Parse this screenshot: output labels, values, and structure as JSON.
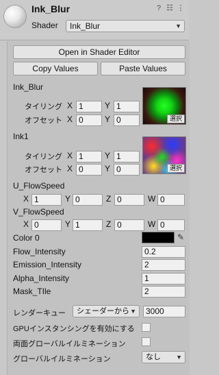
{
  "header": {
    "title": "Ink_Blur",
    "shader_label": "Shader",
    "shader_value": "Ink_Blur"
  },
  "buttons": {
    "open_shader_editor": "Open in Shader Editor",
    "copy_values": "Copy Values",
    "paste_values": "Paste Values"
  },
  "textures": [
    {
      "name": "Ink_Blur",
      "tiling_label": "タイリング",
      "offset_label": "オフセット",
      "tiling_x": "1",
      "tiling_y": "1",
      "offset_x": "0",
      "offset_y": "0",
      "select_label": "選択"
    },
    {
      "name": "Ink1",
      "tiling_label": "タイリング",
      "offset_label": "オフセット",
      "tiling_x": "1",
      "tiling_y": "1",
      "offset_x": "0",
      "offset_y": "0",
      "select_label": "選択"
    }
  ],
  "axis": {
    "x": "X",
    "y": "Y",
    "z": "Z",
    "w": "W"
  },
  "vectors": [
    {
      "name": "U_FlowSpeed",
      "x": "1",
      "y": "0",
      "z": "0",
      "w": "0"
    },
    {
      "name": "V_FlowSpeed",
      "x": "0",
      "y": "1",
      "z": "0",
      "w": "0"
    }
  ],
  "color": {
    "label": "Color 0",
    "value": "#000000"
  },
  "floats": [
    {
      "name": "Flow_Intensity",
      "value": "0.2"
    },
    {
      "name": "Emission_Intensity",
      "value": "2"
    },
    {
      "name": "Alpha_Intensity",
      "value": "1"
    },
    {
      "name": "Mask_TIle",
      "value": "2"
    }
  ],
  "render_queue": {
    "label": "レンダーキュー",
    "mode": "シェーダーから",
    "value": "3000"
  },
  "gpu_instancing": {
    "label": "GPUインスタンシングを有効にする",
    "checked": false
  },
  "double_sided_gi": {
    "label": "両面グローバルイルミネーション",
    "checked": false
  },
  "global_illumination": {
    "label": "グローバルイルミネーション",
    "value": "なし"
  },
  "icons": [
    "help-icon",
    "preset-icon",
    "more-icon",
    "eyedropper-icon",
    "dropdown-arrow-icon"
  ]
}
